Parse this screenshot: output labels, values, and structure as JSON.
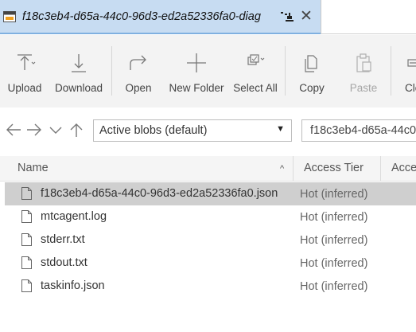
{
  "tab": {
    "title": "f18c3eb4-d65a-44c0-96d3-ed2a52336fa0-diag",
    "icon": "storage-container-icon",
    "pin_icon": "pin-icon",
    "close_symbol": "✕"
  },
  "toolbar": {
    "upload_label": "Upload",
    "download_label": "Download",
    "open_label": "Open",
    "new_folder_label": "New Folder",
    "select_all_label": "Select All",
    "copy_label": "Copy",
    "paste_label": "Paste",
    "clone_label": "Clo"
  },
  "nav": {
    "back_icon": "arrow-left-icon",
    "forward_icon": "arrow-right-icon",
    "recent_icon": "chevron-down-icon",
    "up_icon": "arrow-up-icon",
    "blob_filter_selected": "Active blobs (default)",
    "dropdown_arrow": "▼",
    "path": "f18c3eb4-d65a-44c0"
  },
  "columns": {
    "name": "Name",
    "access_tier": "Access Tier",
    "access_tier_2": "Acce"
  },
  "sort_symbol": "^",
  "files": [
    {
      "name": "f18c3eb4-d65a-44c0-96d3-ed2a52336fa0.json",
      "tier": "Hot (inferred)",
      "selected": true
    },
    {
      "name": "mtcagent.log",
      "tier": "Hot (inferred)",
      "selected": false
    },
    {
      "name": "stderr.txt",
      "tier": "Hot (inferred)",
      "selected": false
    },
    {
      "name": "stdout.txt",
      "tier": "Hot (inferred)",
      "selected": false
    },
    {
      "name": "taskinfo.json",
      "tier": "Hot (inferred)",
      "selected": false
    }
  ],
  "colors": {
    "tab_active_bg": "#c7dcf2",
    "toolbar_bg": "#f3f3f3",
    "selected_row_bg": "#cfcfcf"
  }
}
